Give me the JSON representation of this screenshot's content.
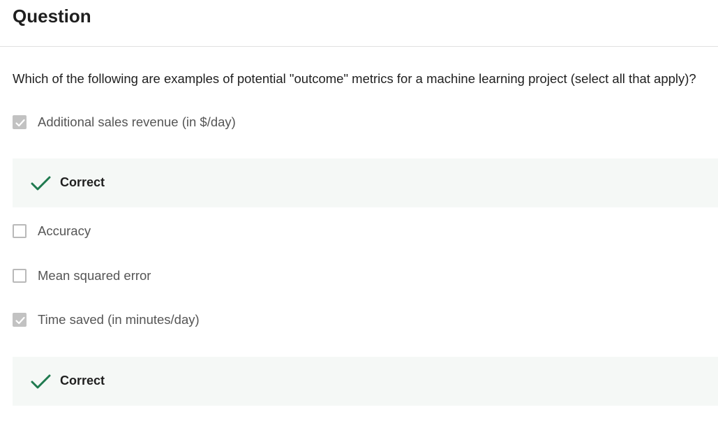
{
  "header": {
    "title": "Question"
  },
  "question": {
    "text": "Which of the following are examples of potential \"outcome\" metrics for a machine learning project (select all that apply)?"
  },
  "options": [
    {
      "label": "Additional sales revenue (in $/day)",
      "checked": true,
      "feedback": "Correct"
    },
    {
      "label": "Accuracy",
      "checked": false
    },
    {
      "label": "Mean squared error",
      "checked": false
    },
    {
      "label": "Time saved (in minutes/day)",
      "checked": true,
      "feedback": "Correct"
    }
  ],
  "colors": {
    "correct_check": "#1f7a4f",
    "feedback_bg": "#f5f8f6",
    "checked_box": "#c2c2c2"
  },
  "icons": {
    "checkbox_checked": "check-icon",
    "feedback": "checkmark-icon"
  }
}
